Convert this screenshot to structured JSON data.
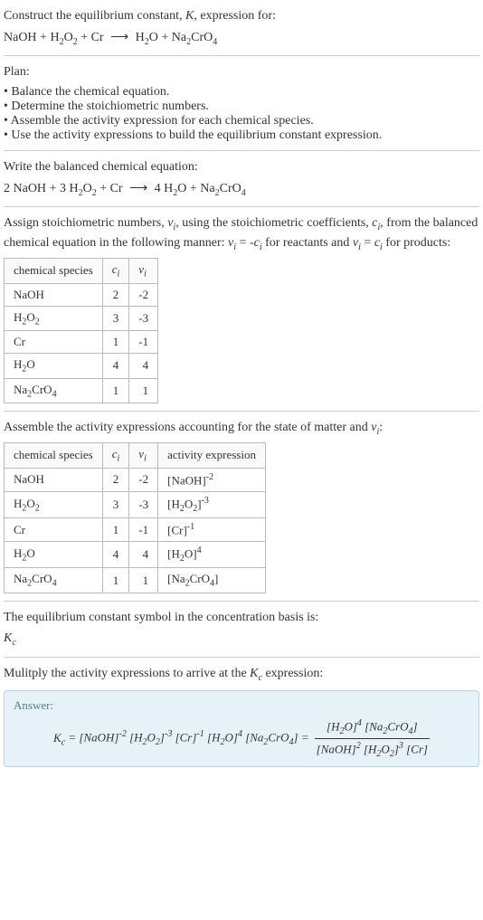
{
  "intro": {
    "construct": "Construct the equilibrium constant, K, expression for:",
    "equation": "NaOH + H₂O₂ + Cr ⟶ H₂O + Na₂CrO₄"
  },
  "plan": {
    "label": "Plan:",
    "items": [
      "Balance the chemical equation.",
      "Determine the stoichiometric numbers.",
      "Assemble the activity expression for each chemical species.",
      "Use the activity expressions to build the equilibrium constant expression."
    ]
  },
  "balanced": {
    "label": "Write the balanced chemical equation:",
    "equation": "2 NaOH + 3 H₂O₂ + Cr ⟶ 4 H₂O + Na₂CrO₄"
  },
  "stoich": {
    "intro": "Assign stoichiometric numbers, νᵢ, using the stoichiometric coefficients, cᵢ, from the balanced chemical equation in the following manner: νᵢ = -cᵢ for reactants and νᵢ = cᵢ for products:",
    "headers": [
      "chemical species",
      "cᵢ",
      "νᵢ"
    ],
    "rows": [
      {
        "species": "NaOH",
        "c": "2",
        "v": "-2"
      },
      {
        "species": "H₂O₂",
        "c": "3",
        "v": "-3"
      },
      {
        "species": "Cr",
        "c": "1",
        "v": "-1"
      },
      {
        "species": "H₂O",
        "c": "4",
        "v": "4"
      },
      {
        "species": "Na₂CrO₄",
        "c": "1",
        "v": "1"
      }
    ]
  },
  "activity": {
    "intro": "Assemble the activity expressions accounting for the state of matter and νᵢ:",
    "headers": [
      "chemical species",
      "cᵢ",
      "νᵢ",
      "activity expression"
    ],
    "rows": [
      {
        "species": "NaOH",
        "c": "2",
        "v": "-2",
        "expr": "[NaOH]⁻²"
      },
      {
        "species": "H₂O₂",
        "c": "3",
        "v": "-3",
        "expr": "[H₂O₂]⁻³"
      },
      {
        "species": "Cr",
        "c": "1",
        "v": "-1",
        "expr": "[Cr]⁻¹"
      },
      {
        "species": "H₂O",
        "c": "4",
        "v": "4",
        "expr": "[H₂O]⁴"
      },
      {
        "species": "Na₂CrO₄",
        "c": "1",
        "v": "1",
        "expr": "[Na₂CrO₄]"
      }
    ]
  },
  "symbol": {
    "line1": "The equilibrium constant symbol in the concentration basis is:",
    "line2": "K_c"
  },
  "multiply": {
    "intro": "Mulitply the activity expressions to arrive at the K_c expression:"
  },
  "answer": {
    "label": "Answer:",
    "kc": "K_c =",
    "flat": "[NaOH]⁻² [H₂O₂]⁻³ [Cr]⁻¹ [H₂O]⁴ [Na₂CrO₄] =",
    "num": "[H₂O]⁴ [Na₂CrO₄]",
    "den": "[NaOH]² [H₂O₂]³ [Cr]"
  }
}
